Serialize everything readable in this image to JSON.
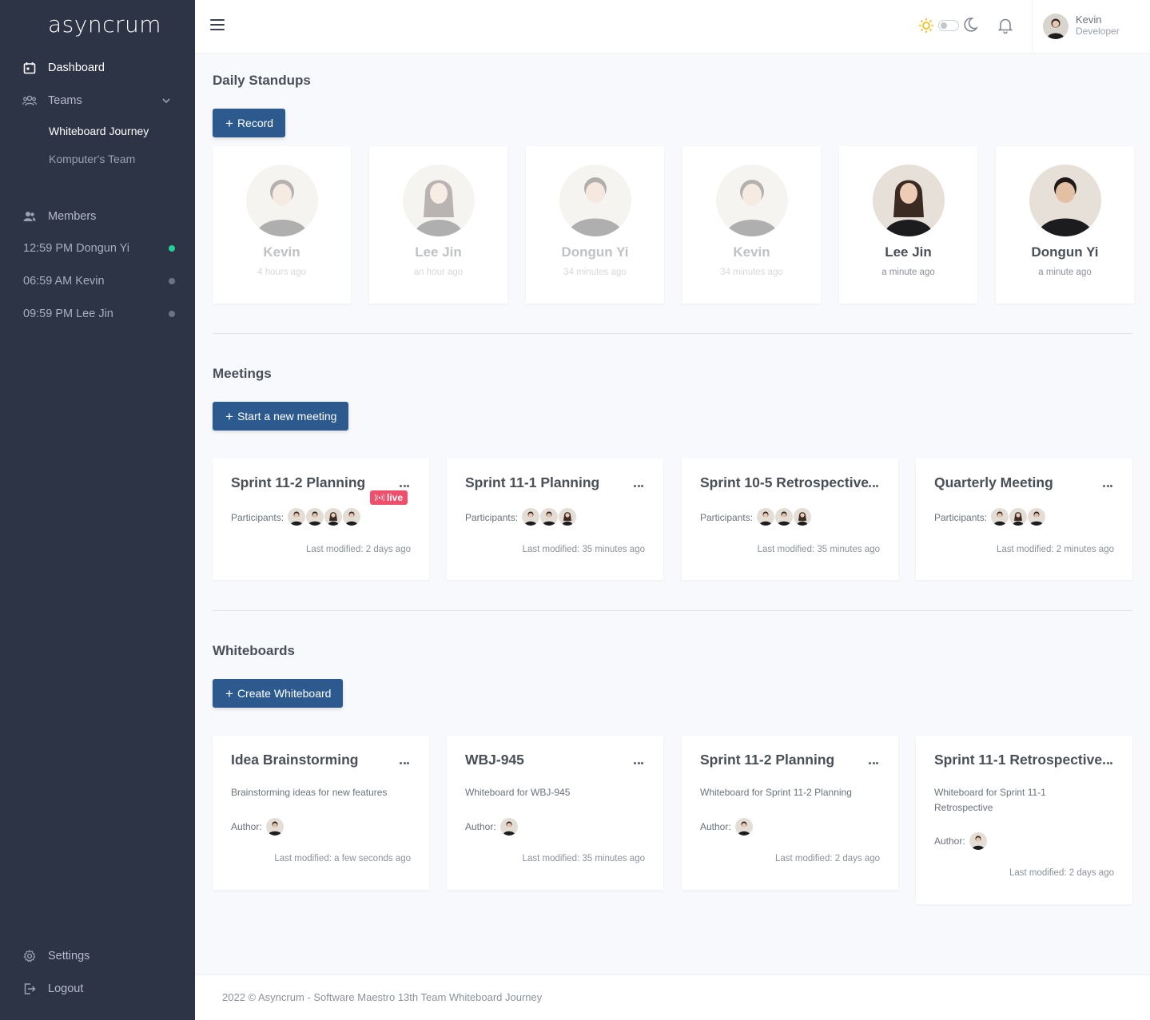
{
  "app": {
    "logo": "asyncrum"
  },
  "sidebar": {
    "dashboard": "Dashboard",
    "teams": "Teams",
    "team_items": [
      "Whiteboard Journey",
      "Komputer's Team"
    ],
    "members_label": "Members",
    "members": [
      {
        "label": "12:59 PM Dongun Yi",
        "status": "online"
      },
      {
        "label": "06:59 AM Kevin",
        "status": "offline"
      },
      {
        "label": "09:59 PM Lee Jin",
        "status": "offline"
      }
    ],
    "settings": "Settings",
    "logout": "Logout"
  },
  "header": {
    "user_name": "Kevin",
    "user_role": "Developer"
  },
  "standups": {
    "title": "Daily Standups",
    "button": "Record",
    "cards": [
      {
        "name": "Kevin",
        "time": "4 hours ago",
        "faded": true
      },
      {
        "name": "Lee Jin",
        "time": "an hour ago",
        "faded": true
      },
      {
        "name": "Dongun Yi",
        "time": "34 minutes ago",
        "faded": true
      },
      {
        "name": "Kevin",
        "time": "34 minutes ago",
        "faded": true
      },
      {
        "name": "Lee Jin",
        "time": "a minute ago",
        "faded": false
      },
      {
        "name": "Dongun Yi",
        "time": "a minute ago",
        "faded": false
      }
    ]
  },
  "meetings": {
    "title": "Meetings",
    "button": "Start a new meeting",
    "participants_label": "Participants:",
    "cards": [
      {
        "title": "Sprint 11-2 Planning",
        "live": "live",
        "modified": "Last modified: 2 days ago"
      },
      {
        "title": "Sprint 11-1 Planning",
        "modified": "Last modified: 35 minutes ago"
      },
      {
        "title": "Sprint 10-5 Retrospective",
        "modified": "Last modified: 35 minutes ago"
      },
      {
        "title": "Quarterly Meeting",
        "modified": "Last modified: 2 minutes ago"
      }
    ]
  },
  "whiteboards": {
    "title": "Whiteboards",
    "button": "Create Whiteboard",
    "author_label": "Author:",
    "cards": [
      {
        "title": "Idea Brainstorming",
        "desc": "Brainstorming ideas for new features",
        "modified": "Last modified: a few seconds ago"
      },
      {
        "title": "WBJ-945",
        "desc": "Whiteboard for WBJ-945",
        "modified": "Last modified: 35 minutes ago"
      },
      {
        "title": "Sprint 11-2 Planning",
        "desc": "Whiteboard for Sprint 11-2 Planning",
        "modified": "Last modified: 2 days ago"
      },
      {
        "title": "Sprint 11-1 Retrospective",
        "desc": "Whiteboard for Sprint 11-1 Retrospective",
        "modified": "Last modified: 2 days ago"
      }
    ]
  },
  "footer": {
    "text": "2022 © Asyncrum - Software Maestro 13th Team Whiteboard Journey"
  },
  "colors": {
    "sidebar": "#2d3446",
    "primary_button": "#2c5a8f",
    "live_badge": "#ef4f6b",
    "online": "#1ed39a"
  }
}
